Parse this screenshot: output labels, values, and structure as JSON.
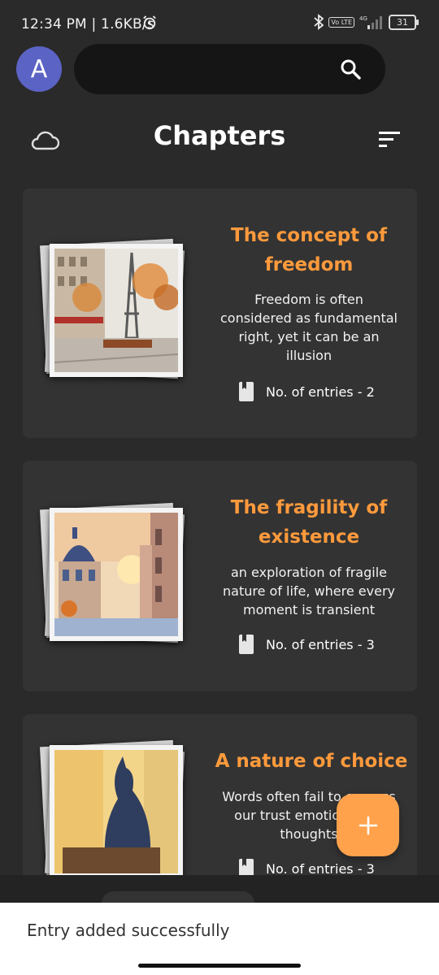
{
  "status_bar": {
    "time": "12:34 PM | 1.6KB/s",
    "network": "4G",
    "volte": "Vo LTE",
    "battery": "31"
  },
  "header": {
    "avatar_letter": "A",
    "search_placeholder": "",
    "title": "Chapters"
  },
  "chapters": [
    {
      "title": "The concept of freedom",
      "description": "Freedom is often considered as fundamental right, yet it can be an illusion",
      "entries": "No. of entries - 2"
    },
    {
      "title": "The fragility of existence",
      "description": "an exploration of fragile nature of life, where every moment is transient",
      "entries": "No. of entries - 3"
    },
    {
      "title": "A nature of choice",
      "description": "Words often fail to express our trust emotions and thoughts",
      "entries": "No. of entries - 3"
    }
  ],
  "snackbar": {
    "message": "Entry added successfully"
  },
  "colors": {
    "accent": "#ff9a3c",
    "fab": "#ffa24b",
    "avatar": "#5b63c4",
    "background": "#2a2a2a",
    "card": "#333333"
  },
  "icons": [
    "alarm-icon",
    "bluetooth-icon",
    "signal-icon",
    "battery-icon",
    "search-icon",
    "dark-mode-icon",
    "cloud-icon",
    "sort-icon",
    "book-icon",
    "add-icon"
  ]
}
